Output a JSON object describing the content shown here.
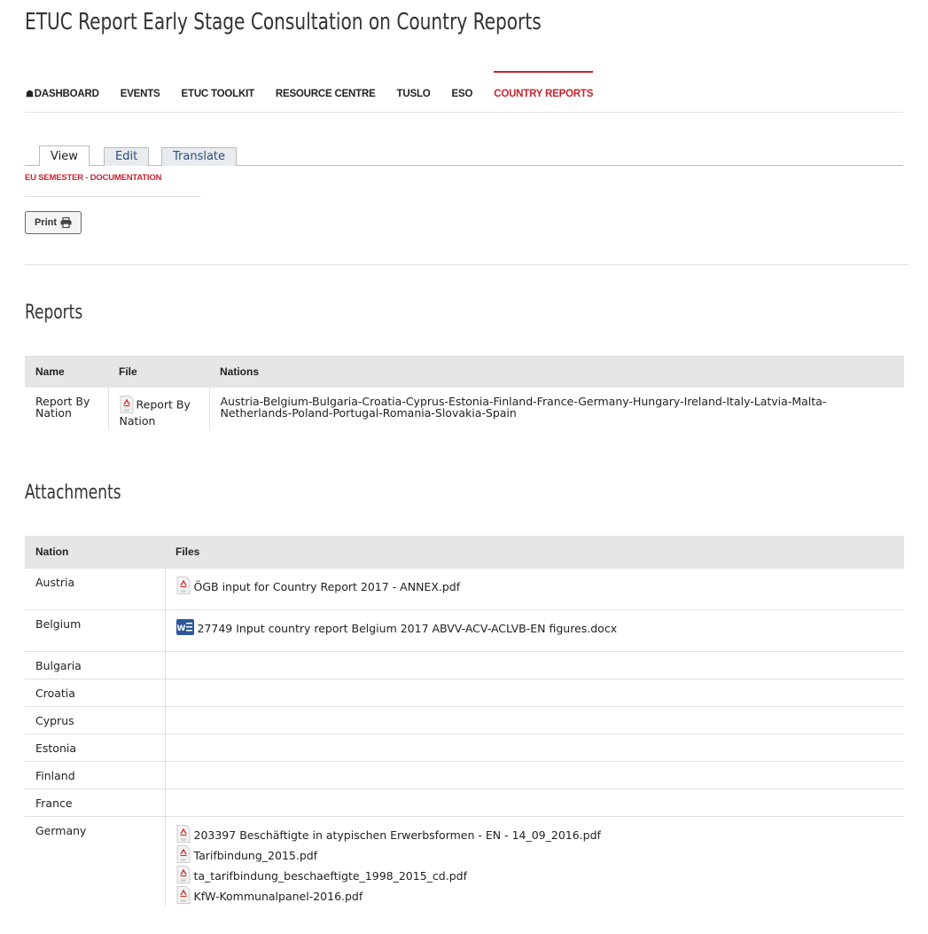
{
  "page": {
    "title": "ETUC Report Early Stage Consultation on Country Reports"
  },
  "nav": {
    "items": [
      {
        "label": "DASHBOARD",
        "icon": "home-icon"
      },
      {
        "label": "EVENTS"
      },
      {
        "label": "ETUC TOOLKIT"
      },
      {
        "label": "RESOURCE CENTRE"
      },
      {
        "label": "TUSLO"
      },
      {
        "label": "ESO"
      },
      {
        "label": "COUNTRY REPORTS",
        "active": true
      }
    ],
    "active_color": "#c8232f"
  },
  "tabs": [
    {
      "label": "View",
      "active": true
    },
    {
      "label": "Edit"
    },
    {
      "label": "Translate"
    }
  ],
  "breadcrumb": "EU SEMESTER - DOCUMENTATION",
  "print": {
    "label": "Print",
    "icon": "printer-icon"
  },
  "reports": {
    "heading": "Reports",
    "columns": [
      "Name",
      "File",
      "Nations"
    ],
    "rows": [
      {
        "name": "Report By Nation",
        "file": "Report By Nation",
        "file_icon": "pdf-icon",
        "nations": "Austria-Belgium-Bulgaria-Croatia-Cyprus-Estonia-Finland-France-Germany-Hungary-Ireland-Italy-Latvia-Malta-Netherlands-Poland-Portugal-Romania-Slovakia-Spain"
      }
    ]
  },
  "attachments": {
    "heading": "Attachments",
    "columns": [
      "Nation",
      "Files"
    ],
    "rows": [
      {
        "nation": "Austria",
        "files": [
          {
            "name": "ÖGB input for Country Report 2017 - ANNEX.pdf",
            "icon": "pdf-icon"
          }
        ]
      },
      {
        "nation": "Belgium",
        "files": [
          {
            "name": "27749 Input country report Belgium 2017 ABVV-ACV-ACLVB-EN figures.docx",
            "icon": "word-icon"
          }
        ]
      },
      {
        "nation": "Bulgaria",
        "files": []
      },
      {
        "nation": "Croatia",
        "files": []
      },
      {
        "nation": "Cyprus",
        "files": []
      },
      {
        "nation": "Estonia",
        "files": []
      },
      {
        "nation": "Finland",
        "files": []
      },
      {
        "nation": "France",
        "files": []
      },
      {
        "nation": "Germany",
        "files": [
          {
            "name": "203397 Beschäftigte in atypischen Erwerbsformen - EN - 14_09_2016.pdf",
            "icon": "pdf-icon"
          },
          {
            "name": "Tarifbindung_2015.pdf",
            "icon": "pdf-icon"
          },
          {
            "name": "ta_tarifbindung_beschaeftigte_1998_2015_cd.pdf",
            "icon": "pdf-icon"
          },
          {
            "name": "KfW-Kommunalpanel-2016.pdf",
            "icon": "pdf-icon"
          }
        ]
      }
    ]
  }
}
